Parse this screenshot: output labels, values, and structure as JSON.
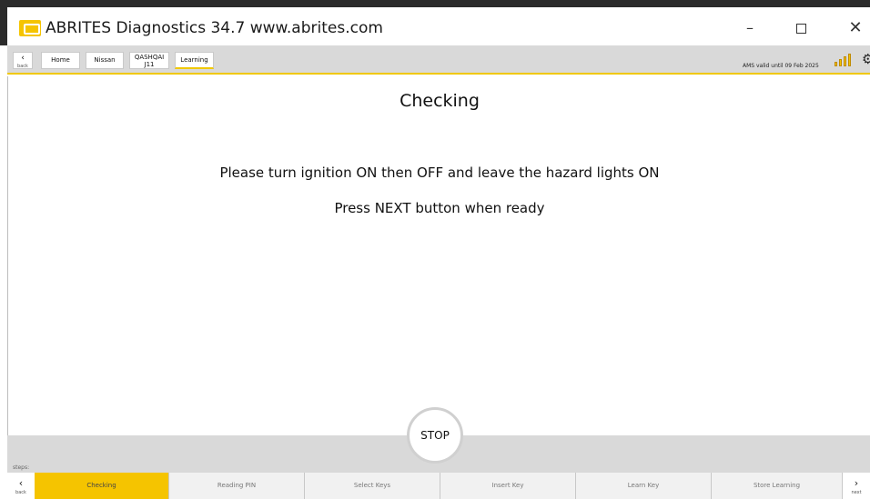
{
  "window": {
    "title": "ABRITES Diagnostics 34.7   www.abrites.com",
    "minimize_glyph": "–",
    "close_glyph": "✕"
  },
  "nav": {
    "back_glyph": "‹",
    "back_label": "back",
    "breadcrumbs": [
      "Home",
      "Nissan",
      "QASHQAI\nJ11",
      "Learning"
    ],
    "ams_status": "AMS valid until 09 Feb 2025",
    "settings_glyph": "⚙"
  },
  "main": {
    "heading": "Checking",
    "instruction": "Please turn ignition ON then OFF and leave the hazard lights ON",
    "prompt": "Press NEXT button when ready"
  },
  "stop_label": "STOP",
  "steps": {
    "label": "steps:",
    "back_glyph": "‹",
    "back_label": "back",
    "next_glyph": "›",
    "next_label": "next",
    "items": [
      "Checking",
      "Reading PIN",
      "Select Keys",
      "Insert Key",
      "Learn Key",
      "Store Learning"
    ],
    "active_index": 0
  },
  "colors": {
    "accent": "#f5c400",
    "toolbar_bg": "#d9d9d9"
  }
}
